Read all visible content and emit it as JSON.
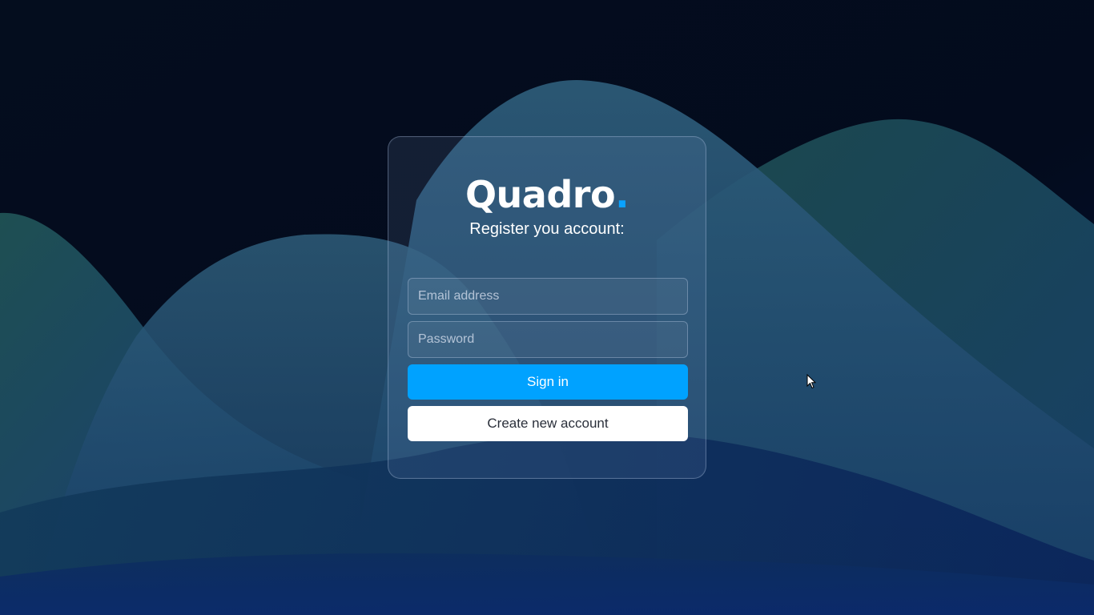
{
  "brand": {
    "name": "Quadro",
    "dot": "."
  },
  "form": {
    "subtitle": "Register you account:",
    "email_placeholder": "Email address",
    "password_placeholder": "Password",
    "sign_in_label": "Sign in",
    "create_account_label": "Create new account"
  },
  "colors": {
    "accent": "#00a2ff",
    "background": "#030a1c"
  },
  "icons": {
    "cursor": "arrow-cursor-icon"
  }
}
